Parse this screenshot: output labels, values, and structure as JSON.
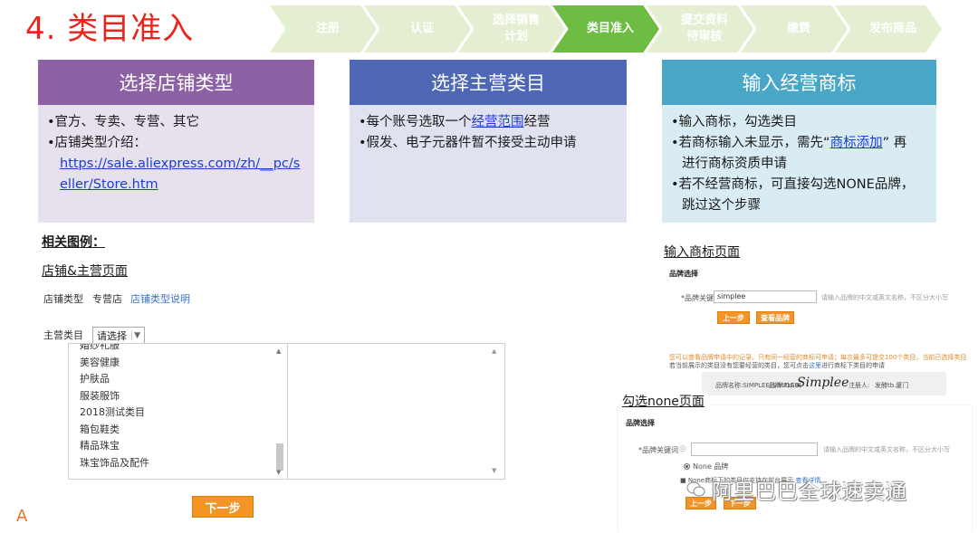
{
  "title": "4. 类目准入",
  "steps": [
    {
      "label": "注册",
      "active": false
    },
    {
      "label": "认证",
      "active": false
    },
    {
      "label": "选择销售\n计划",
      "active": false
    },
    {
      "label": "类目准入",
      "active": true
    },
    {
      "label": "提交资料\n待审核",
      "active": false
    },
    {
      "label": "缴费",
      "active": false
    },
    {
      "label": "发布商品",
      "active": false
    }
  ],
  "cards": {
    "shop_type": {
      "heading": "选择店铺类型",
      "line1": "•官方、专卖、专营、其它",
      "line2": "•店铺类型介绍：",
      "link": "https://sale.aliexpress.com/zh/__pc/seller/Store.htm"
    },
    "main_category": {
      "heading": "选择主营类目",
      "line1_pre": "•每个账号选取一个",
      "line1_link": "经营范围",
      "line1_post": "经营",
      "line2": "•假发、电子元器件暂不接受主动申请"
    },
    "trademark": {
      "heading": "输入经营商标",
      "line1": "•输入商标，勾选类目",
      "line2_pre": "•若商标输入未显示，需先“",
      "line2_link": "商标添加",
      "line2_post": "” 再",
      "line3": "进行商标资质申请",
      "line4": "•若不经营商标，可直接勾选NONE品牌，",
      "line5": "跳过这个步骤"
    }
  },
  "examples": {
    "heading": "相关图例：",
    "left_caption": "店铺&主营页面",
    "shop_type_label": "店铺类型",
    "shop_type_value": "专营店",
    "shop_type_link": "店铺类型说明",
    "main_cat_label": "主营类目",
    "select_value": "请选择",
    "category_items": [
      "婚纱礼服",
      "美容健康",
      "护肤品",
      "服装服饰",
      "2018测试类目",
      "箱包鞋类",
      "精品珠宝",
      "珠宝饰品及配件"
    ],
    "next_button": "下一步",
    "right_caption_top": "输入商标页面",
    "brand_select": "品牌选择",
    "brand_keyword_label": "*品牌关键词",
    "brand_keyword_value": "simplee",
    "brand_hint": "请输入品牌的中文或英文名称，不区分大小写",
    "prev_button": "上一步",
    "view_brand_button": "查看品牌",
    "notice_line1": "您可以查看品牌申请中的记录，只有同一经营的商标可申请；每次最多可提交100个类目，当前已选择类目",
    "notice_line2_pre": "若当前展示的类目没有您要经营的类目，您可点击",
    "notice_line2_link": "这里",
    "notice_line2_post": "进行商标下类目的申请",
    "brand_name_label": "品牌名称:SIMPLEE(SIMPLEE)",
    "brand_logo_label": "品牌LOGO:",
    "brand_logo_text": "Simplee",
    "registrant": "注册人:",
    "registrant_value": "发酵tb.厦门",
    "right_caption_bottom": "勾选none页面",
    "brand_select2": "品牌选择",
    "brand_keyword_label2": "*品牌关键词",
    "brand_hint2": "请输入品牌的中文或英文名称，不区分大小写",
    "none_option": "None 品牌",
    "none_other": "■ None商标下的类目仅支持在前台展示",
    "view_link": "查看详情",
    "prev_button2": "上一步",
    "next_button2": "下一步",
    "left_edge_letter": "A"
  },
  "watermark": "阿里巴巴全球速卖通"
}
